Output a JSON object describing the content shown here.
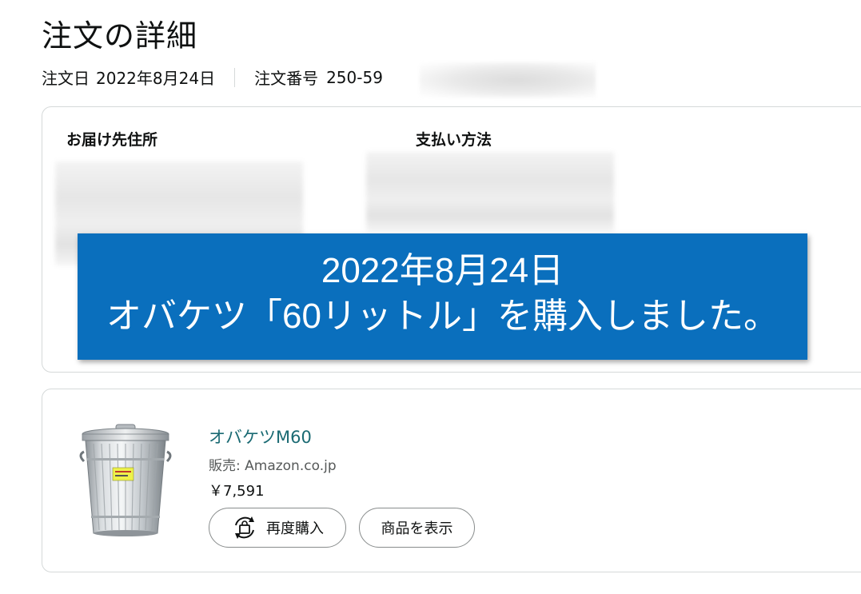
{
  "header": {
    "title": "注文の詳細",
    "order_date_label": "注文日",
    "order_date": "2022年8月24日",
    "order_number_label": "注文番号",
    "order_number_visible": "250-59"
  },
  "address_card": {
    "shipping_heading": "お届け先住所",
    "payment_heading": "支払い方法"
  },
  "banner": {
    "line1": "2022年8月24日",
    "line2": "オバケツ「60リットル」を購入しました。",
    "bg_color": "#0a6fbd"
  },
  "item": {
    "title": "オバケツM60",
    "seller": "販売: Amazon.co.jp",
    "price": "￥7,591",
    "rebuy_label": "再度購入",
    "view_label": "商品を表示",
    "image_icon": "galvanized-trash-can-image",
    "link_color": "#1a6a73"
  }
}
